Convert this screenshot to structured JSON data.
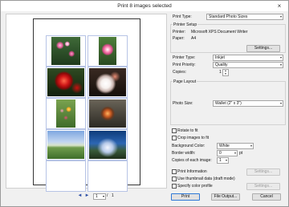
{
  "window": {
    "title": "Print  8 images selected",
    "close_glyph": "×"
  },
  "preview": {
    "photos": [
      "flowers-pink",
      "pink-rose",
      "red-flower",
      "white-flower",
      "flower-bed",
      "bird",
      "landscape-sky",
      "blue-sky"
    ]
  },
  "pager": {
    "prev_glyph": "◄",
    "next_glyph": "►",
    "current": "1",
    "separator": "/",
    "total": "1",
    "dropdown_glyph": "▾"
  },
  "settings": {
    "printer_type_label": "Print Type:",
    "printer_type_value": "Standard Photo Sizes",
    "printer_setup_group": "Printer Setup",
    "printer_label": "Printer:",
    "printer_value": "Microsoft XPS Document Writer",
    "paper_label": "Paper:",
    "paper_value": "A4",
    "settings_btn": "Settings...",
    "printer_type2_label": "Printer Type:",
    "printer_type2_value": "Inkjet",
    "print_priority_label": "Print Priority:",
    "print_priority_value": "Quality",
    "copies_label": "Copies:",
    "copies_value": "1",
    "page_layout_group": "Page Layout",
    "photo_size_label": "Photo Size:",
    "photo_size_value": "Wallet (2\" x 3\")",
    "rotate_label": "Rotate to fit",
    "crop_label": "Crop images to fit",
    "bg_color_label": "Background Color:",
    "bg_color_value": "White",
    "border_width_label": "Border width:",
    "border_width_value": "0",
    "border_unit": "pt",
    "copies_each_label": "Copies of each image:",
    "copies_each_value": "1",
    "print_info_label": "Print Information",
    "print_info_btn": "Settings...",
    "thumbnail_label": "Use thumbnail data (draft mode)",
    "color_profile_label": "Specify color profile",
    "color_profile_btn": "Settings...",
    "dropdown_glyph": "▾",
    "spin_up": "▲",
    "spin_down": "▼"
  },
  "footer": {
    "print_btn": "Print",
    "file_output_btn": "File Output...",
    "cancel_btn": "Cancel"
  }
}
